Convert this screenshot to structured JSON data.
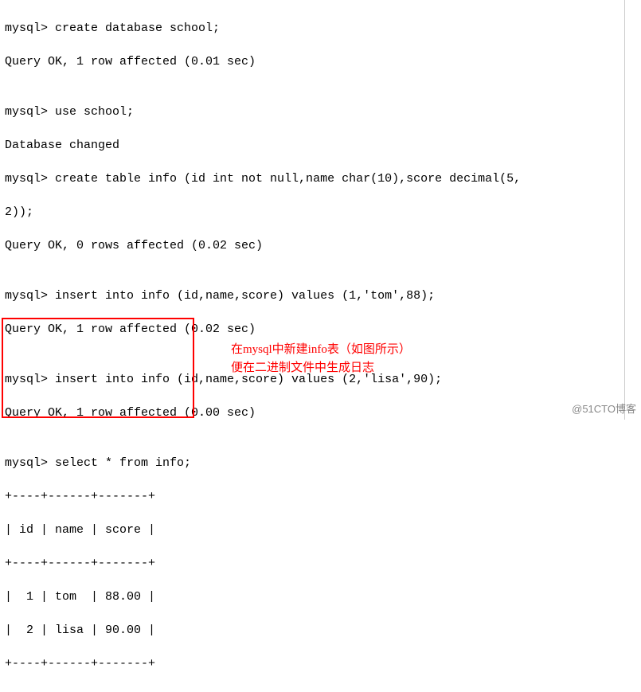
{
  "terminal": {
    "lines": [
      "mysql> create database school;",
      "Query OK, 1 row affected (0.01 sec)",
      "",
      "mysql> use school;",
      "Database changed",
      "mysql> create table info (id int not null,name char(10),score decimal(5,",
      "2));",
      "Query OK, 0 rows affected (0.02 sec)",
      "",
      "mysql> insert into info (id,name,score) values (1,'tom',88);",
      "Query OK, 1 row affected (0.02 sec)",
      "",
      "mysql> insert into info (id,name,score) values (2,'lisa',90);",
      "Query OK, 1 row affected (0.00 sec)",
      "",
      "mysql> select * from info;",
      "+----+------+-------+",
      "| id | name | score |",
      "+----+------+-------+",
      "|  1 | tom  | 88.00 |",
      "|  2 | lisa | 90.00 |",
      "+----+------+-------+"
    ]
  },
  "annotation": {
    "line1": "在mysql中新建info表（如图所示）",
    "line2": "便在二进制文件中生成日志"
  },
  "watermark": "@51CTO博客",
  "chart_data": {
    "type": "table",
    "title": "info",
    "columns": [
      "id",
      "name",
      "score"
    ],
    "rows": [
      {
        "id": 1,
        "name": "tom",
        "score": 88.0
      },
      {
        "id": 2,
        "name": "lisa",
        "score": 90.0
      }
    ]
  }
}
